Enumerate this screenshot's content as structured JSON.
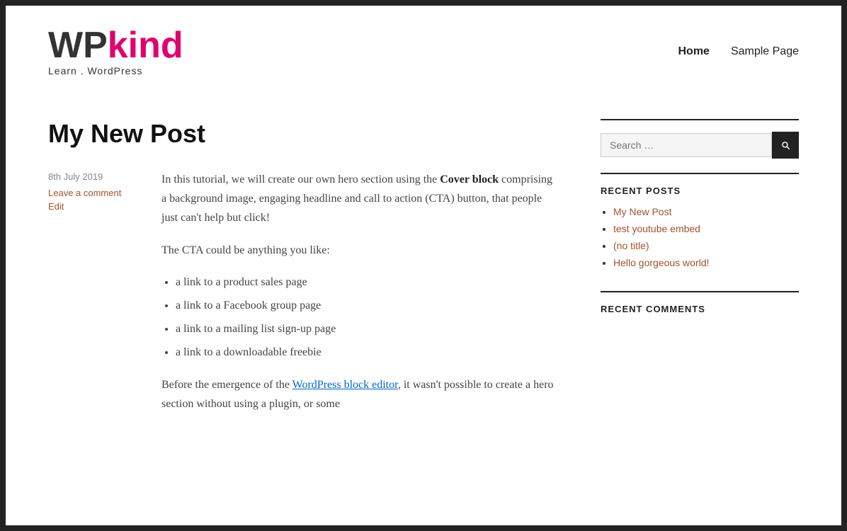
{
  "site": {
    "logo_wp": "WP",
    "logo_kind": "kind",
    "logo_tagline": "Learn . WordPress",
    "border_color": "#222"
  },
  "nav": {
    "items": [
      {
        "label": "Home",
        "active": true
      },
      {
        "label": "Sample Page",
        "active": false
      }
    ]
  },
  "post": {
    "title": "My New Post",
    "date": "8th July 2019",
    "leave_comment": "Leave a comment",
    "edit": "Edit",
    "paragraph1_prefix": "In this tutorial, we will create our own hero section using the ",
    "paragraph1_bold": "Cover block",
    "paragraph1_suffix": " comprising a background image, engaging headline and call to action (CTA) button, that people just can't help but click!",
    "paragraph2": "The CTA could be anything you like:",
    "list_items": [
      "a link to a product sales page",
      "a link to a Facebook group page",
      "a link to a mailing list sign-up page",
      "a link to a downloadable freebie"
    ],
    "paragraph3_prefix": "Before the emergence of the ",
    "paragraph3_link": "WordPress block editor",
    "paragraph3_suffix": ", it wasn't possible to create a hero section without using a plugin, or some"
  },
  "sidebar": {
    "search_placeholder": "Search …",
    "search_icon": "🔍",
    "recent_posts_title": "RECENT POSTS",
    "recent_posts": [
      {
        "label": "My New Post",
        "active": true
      },
      {
        "label": "test youtube embed"
      },
      {
        "label": "(no title)"
      },
      {
        "label": "Hello gorgeous world!"
      }
    ],
    "recent_comments_title": "RECENT COMMENTS"
  }
}
